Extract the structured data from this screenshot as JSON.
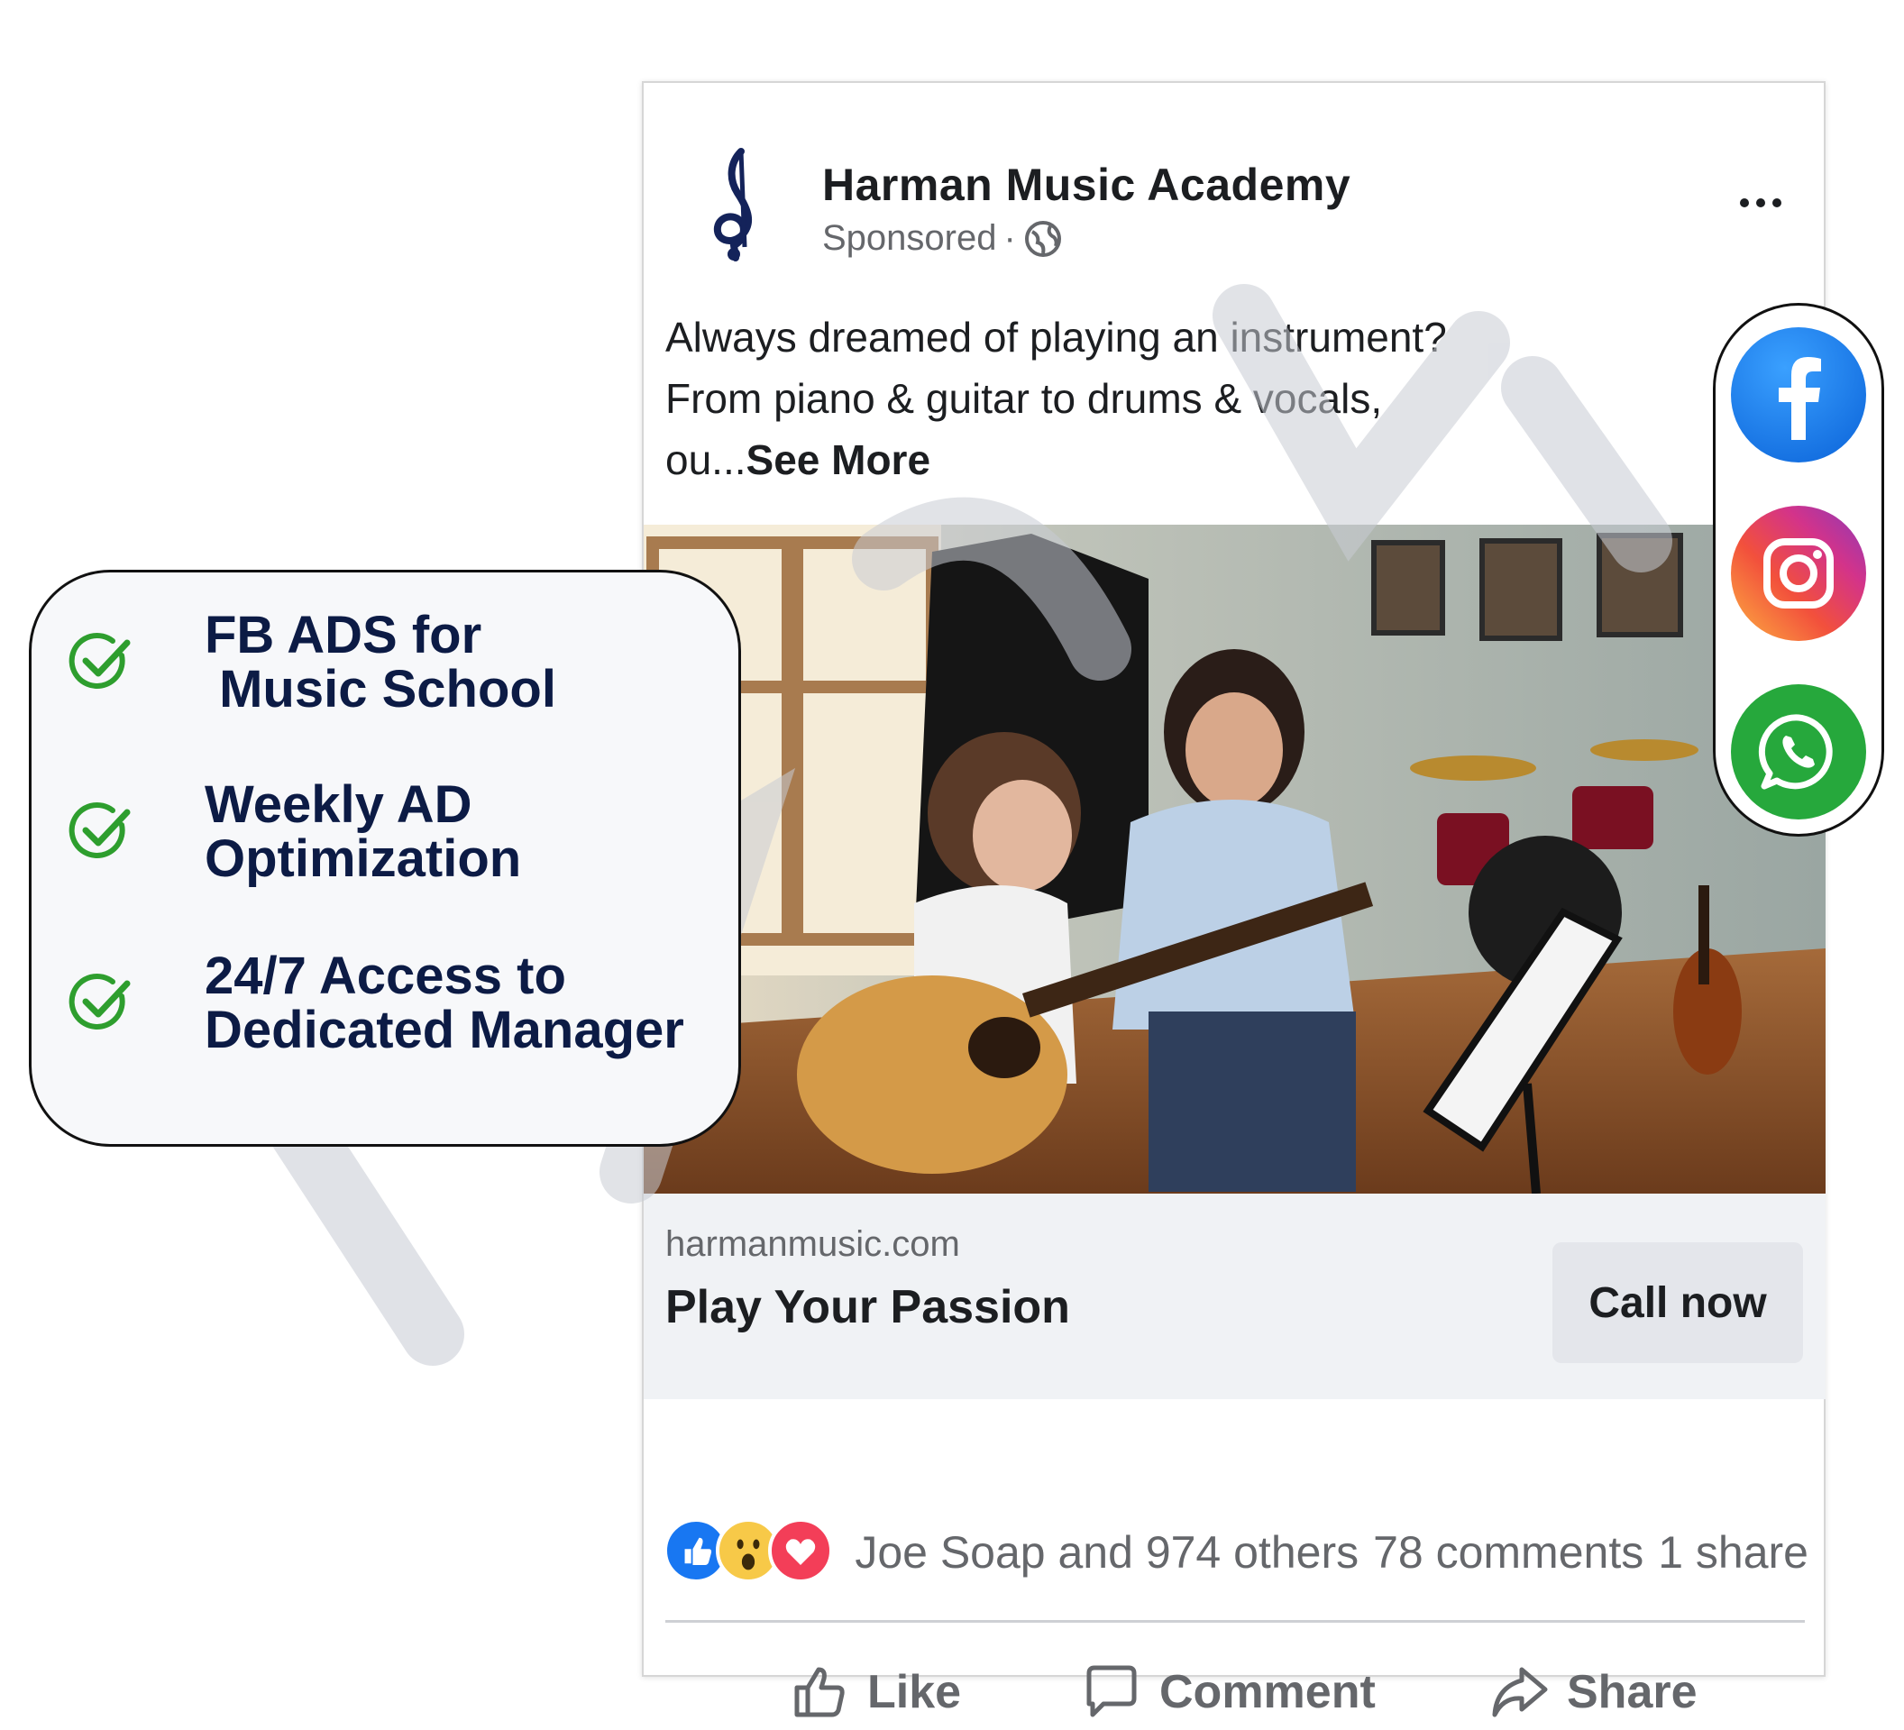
{
  "post": {
    "page_name": "Harman Music Academy",
    "sponsored_label": "Sponsored",
    "separator": "·",
    "text": "Always dreamed of playing an instrument?\nFrom piano & guitar to drums & vocals,\nou...",
    "see_more": "See More",
    "link": {
      "domain": "harmanmusic.com",
      "headline": "Play Your Passion",
      "cta": "Call now"
    },
    "engagement": {
      "reactions_text": "Joe Soap and 974 others",
      "comments": "78 comments",
      "shares": "1 share"
    },
    "actions": [
      "Like",
      "Comment",
      "Share"
    ],
    "colors": {
      "cta_bg": "#e4e6eb",
      "link_bar_bg": "#f0f2f5",
      "muted_text": "#65676b"
    }
  },
  "features": [
    {
      "text": "FB ADS for\n Music School"
    },
    {
      "text": "Weekly AD\nOptimization"
    },
    {
      "text": "24/7 Access to\nDedicated Manager"
    }
  ],
  "features_colors": {
    "text": "#0c1b45",
    "check": "#2e9e2e"
  },
  "social": [
    "facebook-icon",
    "instagram-icon",
    "whatsapp-icon"
  ]
}
